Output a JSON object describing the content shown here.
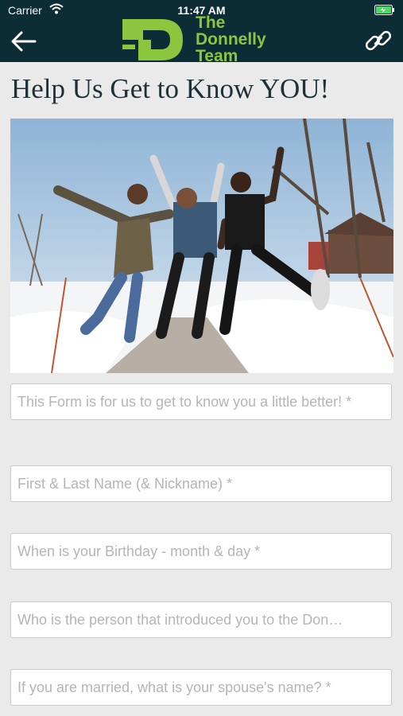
{
  "status_bar": {
    "carrier": "Carrier",
    "time": "11:47 AM"
  },
  "header": {
    "logo_line1": "The",
    "logo_line2": "Donnelly",
    "logo_line3": "Team",
    "brand_color": "#8cc63f",
    "bg_color": "#0d2d36"
  },
  "page": {
    "title": "Help Us Get to Know YOU!"
  },
  "form": {
    "fields": [
      {
        "placeholder": "This Form is for us to get to know you a little better! *"
      },
      {
        "placeholder": "First & Last Name (& Nickname) *"
      },
      {
        "placeholder": "When is your Birthday - month & day *"
      },
      {
        "placeholder": "Who is the person that introduced you to the Don…"
      },
      {
        "placeholder": "If you are married, what is your spouse's name? *"
      }
    ]
  }
}
